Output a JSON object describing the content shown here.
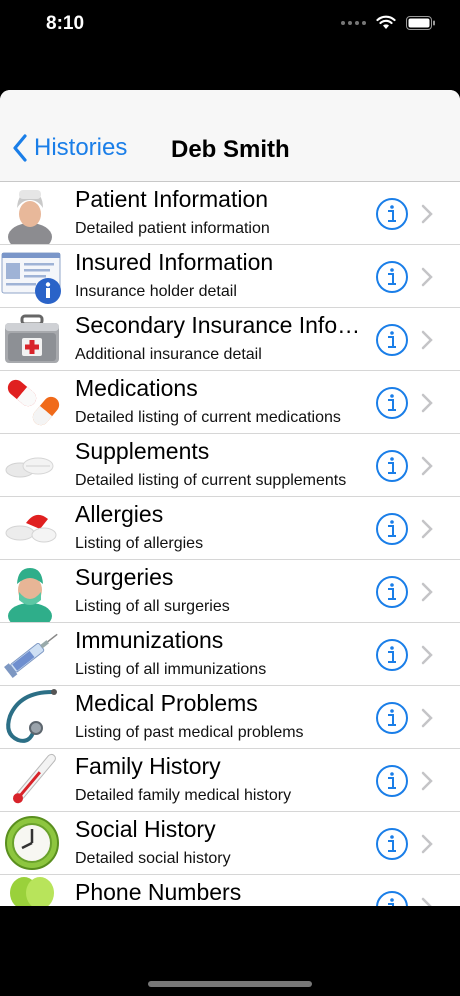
{
  "status": {
    "time": "8:10"
  },
  "nav": {
    "back_label": "Histories",
    "title": "Deb Smith"
  },
  "rows": [
    {
      "title": "Patient Information",
      "subtitle": "Detailed patient information",
      "icon": "patient-icon"
    },
    {
      "title": "Insured Information",
      "subtitle": "Insurance holder detail",
      "icon": "insurance-card-icon"
    },
    {
      "title": "Secondary Insurance Info…",
      "subtitle": "Additional insurance detail",
      "icon": "first-aid-kit-icon"
    },
    {
      "title": "Medications",
      "subtitle": "Detailed listing of current medications",
      "icon": "capsule-pills-icon"
    },
    {
      "title": "Supplements",
      "subtitle": "Detailed listing of current supplements",
      "icon": "tablets-icon"
    },
    {
      "title": "Allergies",
      "subtitle": "Listing of allergies",
      "icon": "allergy-pill-icon"
    },
    {
      "title": "Surgeries",
      "subtitle": "Listing of all surgeries",
      "icon": "surgeon-icon"
    },
    {
      "title": "Immunizations",
      "subtitle": "Listing of all immunizations",
      "icon": "syringe-icon"
    },
    {
      "title": "Medical Problems",
      "subtitle": "Listing of past medical problems",
      "icon": "stethoscope-icon"
    },
    {
      "title": "Family History",
      "subtitle": "Detailed family medical history",
      "icon": "thermometer-icon"
    },
    {
      "title": "Social History",
      "subtitle": "Detailed social history",
      "icon": "clock-icon"
    },
    {
      "title": "Phone Numbers",
      "subtitle": "",
      "icon": "phone-icon"
    }
  ],
  "colors": {
    "accent": "#1a7ee8",
    "background": "#000000"
  }
}
